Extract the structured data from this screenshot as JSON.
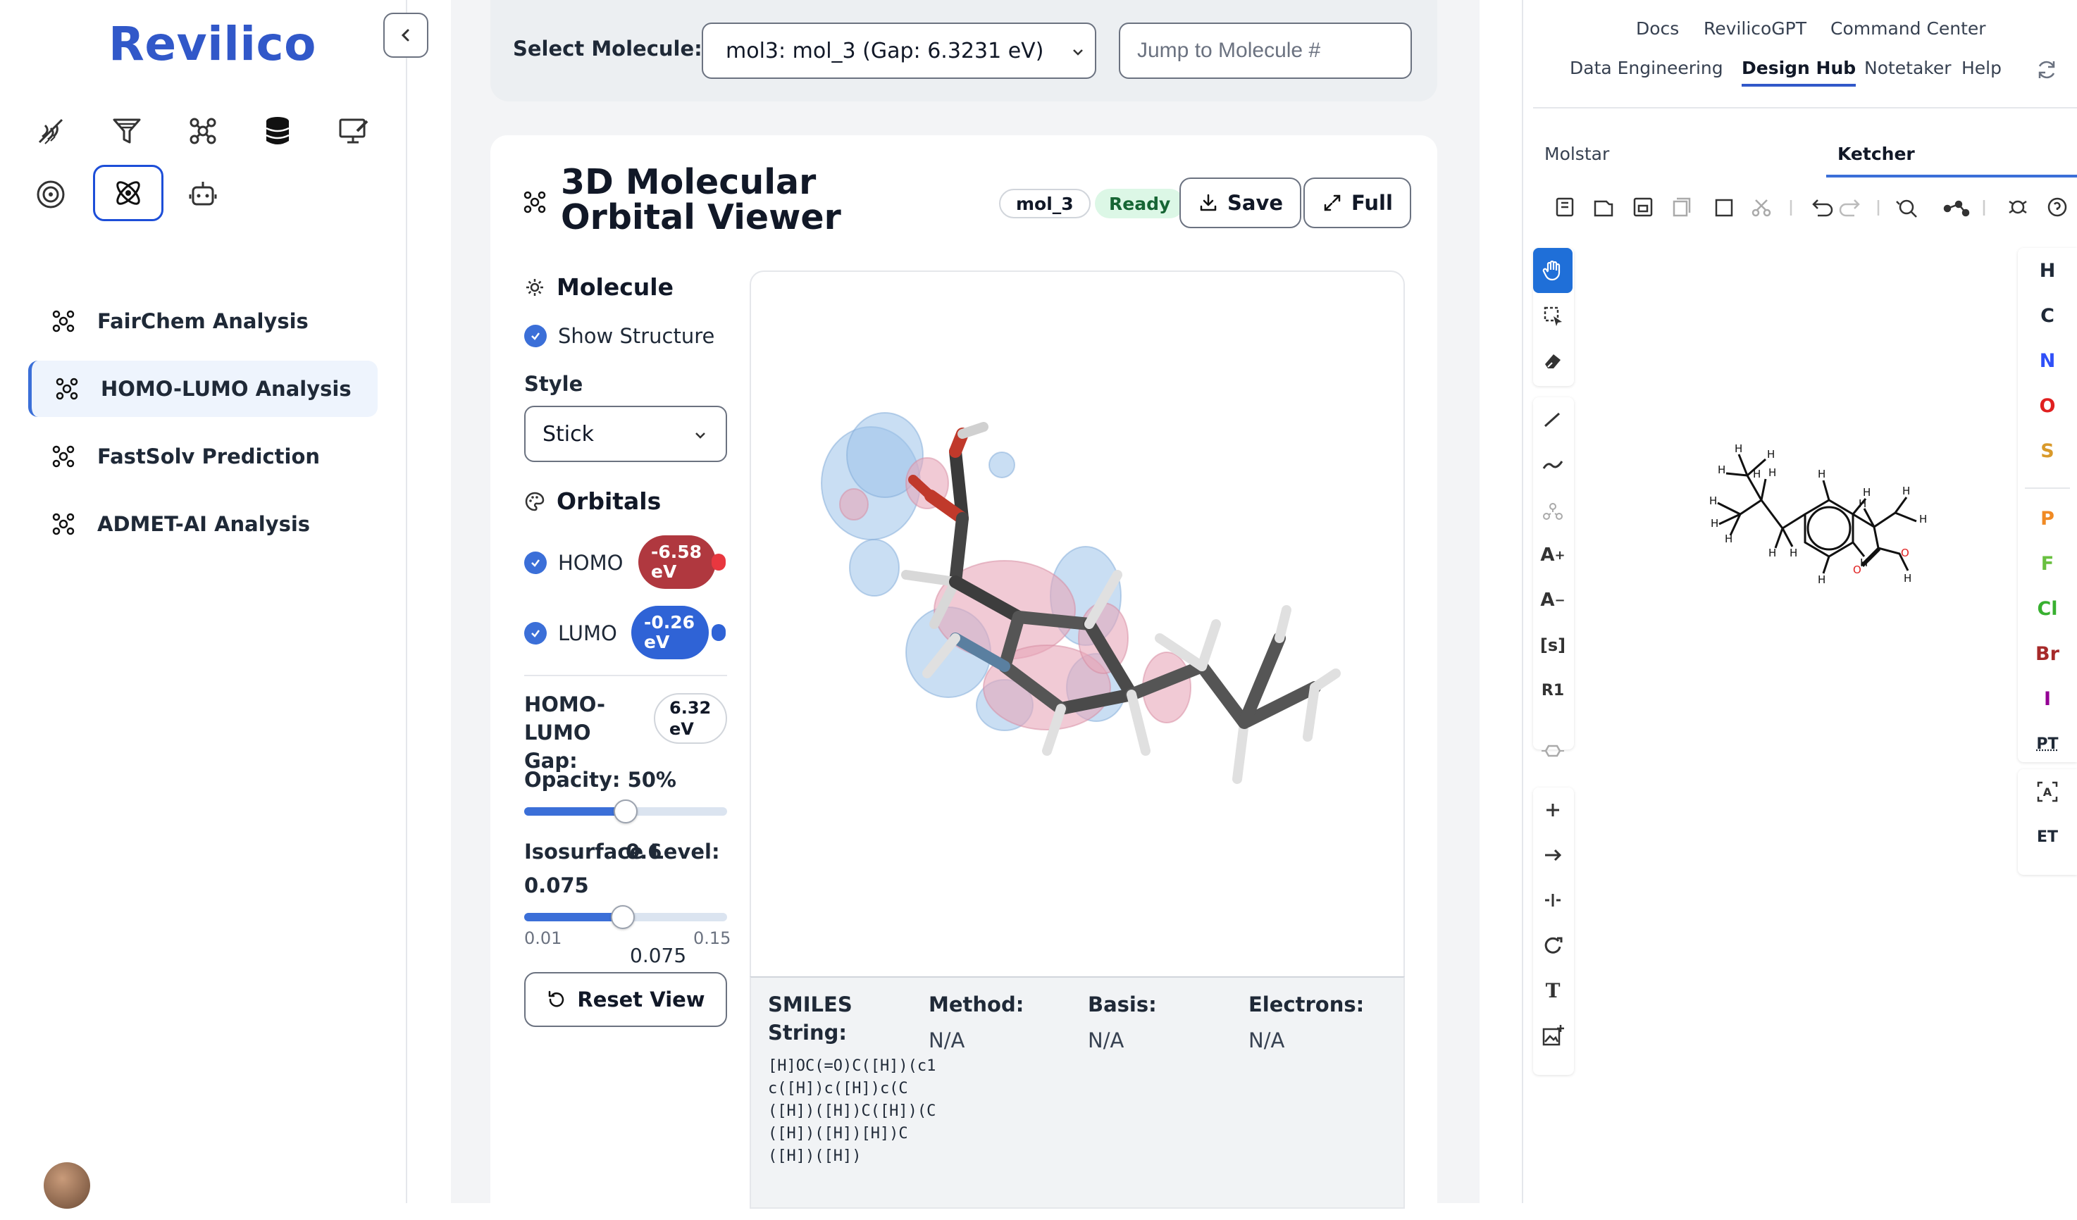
{
  "sidebar": {
    "brand": "Revilico",
    "nav": [
      {
        "label": "FairChem Analysis"
      },
      {
        "label": "HOMO-LUMO Analysis"
      },
      {
        "label": "FastSolv Prediction"
      },
      {
        "label": "ADMET-AI Analysis"
      }
    ],
    "tool_icons": [
      "dna-icon",
      "funnel-icon",
      "molecule-icon",
      "database-icon",
      "monitor-icon",
      "target-icon",
      "atom-icon",
      "robot-icon"
    ]
  },
  "selector": {
    "label": "Select Molecule:",
    "selected": "mol3: mol_3 (Gap: 6.3231 eV)",
    "jump_placeholder": "Jump to Molecule #"
  },
  "viewer": {
    "title": "3D Molecular Orbital Viewer",
    "mol_badge": "mol_3",
    "status": "Ready",
    "save_label": "Save",
    "full_label": "Full",
    "molecule_section": "Molecule",
    "show_structure": "Show Structure",
    "style_label": "Style",
    "style_value": "Stick",
    "orbitals_section": "Orbitals",
    "homo_label": "HOMO",
    "homo_energy": "-6.58 eV",
    "lumo_label": "LUMO",
    "lumo_energy": "-0.26 eV",
    "gap_label": "HOMO-LUMO Gap:",
    "gap_value": "6.32 eV",
    "opacity_label": "Opacity: 50%",
    "opacity_value": 0.5,
    "iso_label": "Isosurface Level:",
    "iso_overlap": "0.6",
    "iso_value": "0.075",
    "iso_fraction": 0.46,
    "iso_min": "0.01",
    "iso_max": "0.15",
    "iso_current": "0.075",
    "reset_label": "Reset View",
    "colors": {
      "homo": "#b0383f",
      "lumo": "#2f63d6",
      "ready_bg": "#dcf7e6"
    }
  },
  "info": {
    "smiles_label": "SMILES String:",
    "smiles": "[H]OC(=O)C([H])(c1c([H])c([H])c(C([H])([H])C([H])(C([H])([H])[H])C([H])([H])",
    "method_label": "Method:",
    "method": "N/A",
    "basis_label": "Basis:",
    "basis": "N/A",
    "electrons_label": "Electrons:",
    "electrons": "N/A"
  },
  "right": {
    "top_links_row1": [
      "Docs",
      "RevilicoGPT",
      "Command Center"
    ],
    "top_links_row2": [
      "Data Engineering",
      "Design Hub",
      "Notetaker",
      "Help"
    ],
    "panel_tabs": [
      "Molstar",
      "Ketcher"
    ],
    "left_tools_text": {
      "add_atom": "A",
      "remove_atom": "A",
      "sgroup": "[s]",
      "rgroup": "R1",
      "text": "T"
    },
    "atoms": [
      {
        "symbol": "H",
        "color": "#111111"
      },
      {
        "symbol": "C",
        "color": "#111111"
      },
      {
        "symbol": "N",
        "color": "#3050f8"
      },
      {
        "symbol": "O",
        "color": "#e02020"
      },
      {
        "symbol": "S",
        "color": "#d99a2b"
      },
      {
        "symbol": "P",
        "color": "#f08a24"
      },
      {
        "symbol": "F",
        "color": "#69c040"
      },
      {
        "symbol": "Cl",
        "color": "#38b030"
      },
      {
        "symbol": "Br",
        "color": "#a62929"
      },
      {
        "symbol": "I",
        "color": "#940094"
      }
    ],
    "periodic_label": "PT",
    "ext_label": "ET",
    "structure_labels": {
      "H": "H",
      "O": "O"
    }
  }
}
